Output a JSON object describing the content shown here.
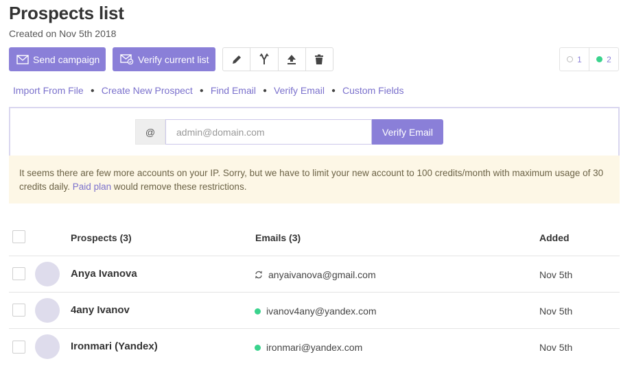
{
  "page": {
    "title": "Prospects list",
    "subtitle": "Created on Nov 5th 2018"
  },
  "toolbar": {
    "send_campaign_label": "Send campaign",
    "verify_list_label": "Verify current list",
    "icons": [
      "pencil-icon",
      "merge-icon",
      "upload-icon",
      "trash-icon"
    ]
  },
  "filters": {
    "unverified_count": "1",
    "valid_count": "2"
  },
  "links": {
    "import": "Import From File",
    "create": "Create New Prospect",
    "find": "Find Email",
    "verify": "Verify Email",
    "custom": "Custom Fields"
  },
  "verify": {
    "addon": "@",
    "placeholder": "admin@domain.com",
    "button_label": "Verify Email"
  },
  "notice": {
    "text": "It seems there are few more accounts on your IP. Sorry, but we have to limit your new account to 100 credits/month with maximum usage of 30 credits daily.",
    "link_text": "Paid plan",
    "suffix": "would remove these restrictions."
  },
  "table": {
    "headers": {
      "prospects": "Prospects (3)",
      "emails": "Emails (3)",
      "added": "Added"
    },
    "rows": [
      {
        "name": "Anya Ivanova",
        "email": "anyaivanova@gmail.com",
        "added": "Nov 5th",
        "status": "pending"
      },
      {
        "name": "4any Ivanov",
        "email": "ivanov4any@yandex.com",
        "added": "Nov 5th",
        "status": "valid"
      },
      {
        "name": "Ironmari (Yandex)",
        "email": "ironmari@yandex.com",
        "added": "Nov 5th",
        "status": "valid"
      }
    ]
  },
  "colors": {
    "accent": "#8a7fd8",
    "link": "#7a70cc",
    "valid": "#3ad38d",
    "notice_bg": "#fdf7e6"
  }
}
